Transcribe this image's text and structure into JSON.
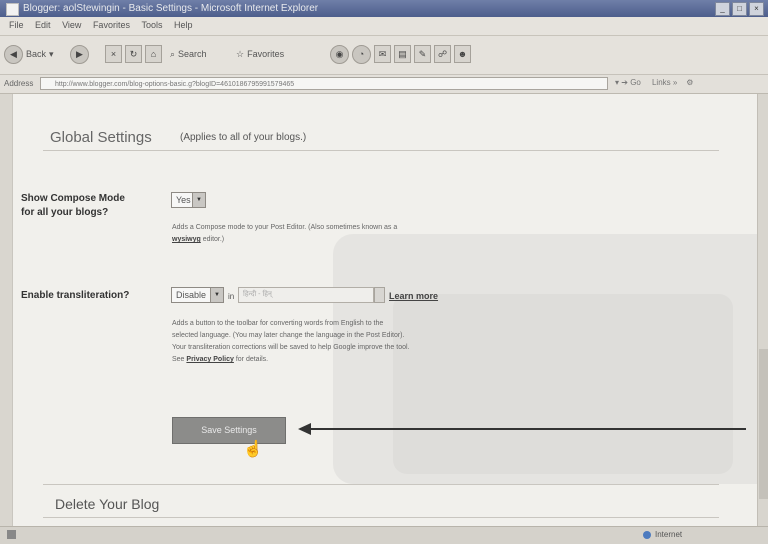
{
  "window": {
    "title": "Blogger: aolStewingin - Basic Settings - Microsoft Internet Explorer",
    "controls": [
      "_",
      "□",
      "×"
    ]
  },
  "menubar": [
    "File",
    "Edit",
    "View",
    "Favorites",
    "Tools",
    "Help"
  ],
  "toolbar": {
    "back": "Back",
    "search": "Search",
    "favorites": "Favorites"
  },
  "address": {
    "label": "Address",
    "url": "http://www.blogger.com/blog-options-basic.g?blogID=4610186795991579465",
    "go": "Go",
    "links": "Links"
  },
  "page": {
    "global_title": "Global Settings",
    "global_subtitle": "(Applies to all of your blogs.)",
    "compose": {
      "label_line1": "Show Compose Mode",
      "label_line2": "for all your blogs?",
      "value": "Yes",
      "help_line1": "Adds a Compose mode to your Post Editor. (Also sometimes known as a",
      "help_link": "wysiwyg",
      "help_line2_rest": " editor.)"
    },
    "transliteration": {
      "label": "Enable transliteration?",
      "value": "Disable",
      "separator": "in",
      "language_value": "हिन्दी - हिन्",
      "learn_more": "Learn more",
      "help_line1": "Adds a button to the toolbar for converting words from English to the",
      "help_line2": "selected language. (You may later change the language in the Post Editor).",
      "help_line3": "Your transliteration corrections will be saved to help Google improve the tool.",
      "help_see": "See ",
      "help_link": "Privacy Policy",
      "help_end": " for details."
    },
    "save_button": "Save Settings",
    "delete_title": "Delete Your Blog"
  },
  "statusbar": {
    "zone": "Internet"
  }
}
